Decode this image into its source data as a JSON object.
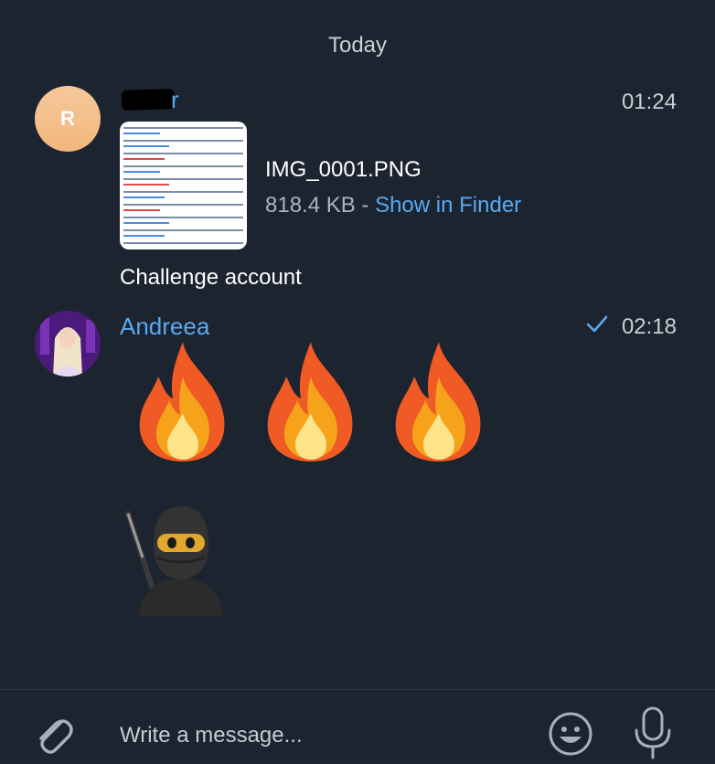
{
  "date_separator": "Today",
  "messages": [
    {
      "avatar_letter": "R",
      "sender_visible_suffix": "r",
      "time": "01:24",
      "attachment": {
        "file_name": "IMG_0001.PNG",
        "file_size": "818.4 KB",
        "separator": " - ",
        "action_label": "Show in Finder"
      },
      "text": "Challenge account"
    },
    {
      "sender": "Andreea",
      "time": "02:18",
      "read_status": "check-icon",
      "emojis": [
        "fire-icon",
        "fire-icon",
        "fire-icon",
        "ninja-icon"
      ]
    }
  ],
  "composer": {
    "placeholder": "Write a message..."
  },
  "colors": {
    "background": "#1c2430",
    "accent": "#5aa9f0",
    "text": "#ffffff",
    "muted": "#c9cfd6"
  }
}
